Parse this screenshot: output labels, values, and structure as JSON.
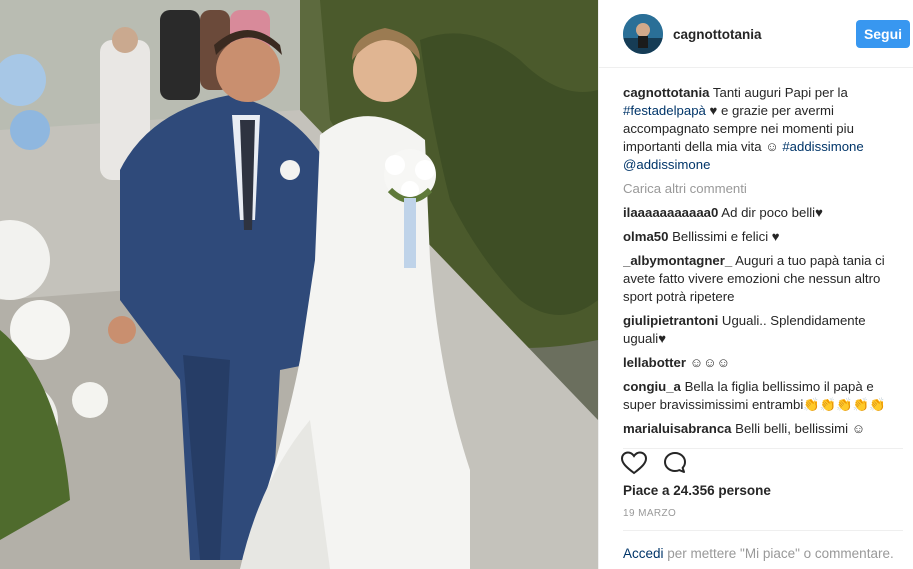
{
  "post": {
    "username": "cagnottotania",
    "follow_label": "Segui",
    "caption": {
      "username": "cagnottotania",
      "text_before": "Tanti auguri Papi per la ",
      "hashtag1": "#festadelpapà",
      "text_middle": " ♥ e grazie per avermi accompagnato sempre nei momenti piu importanti della mia vita ☺ ",
      "hashtag2": "#addissimone",
      "mention": "@addissimone"
    },
    "load_more": "Carica altri commenti",
    "comments": [
      {
        "user": "ilaaaaaaaaaaa0",
        "text": "Ad dir poco belli♥"
      },
      {
        "user": "olma50",
        "text": "Bellissimi e felici ♥"
      },
      {
        "user": "_albymontagner_",
        "text": "Auguri a tuo papà tania ci avete fatto vivere emozioni che nessun altro sport potrà ripetere"
      },
      {
        "user": "giulipietrantoni",
        "text": "Uguali.. Splendidamente uguali♥"
      },
      {
        "user": "lellabotter",
        "text": "☺☺☺"
      },
      {
        "user": "congiu_a",
        "text": "Bella la figlia bellissimo il papà e super bravissimissimi entrambi👏👏👏👏👏"
      },
      {
        "user": "marialuisabranca",
        "text": "Belli belli, bellissimi ☺"
      }
    ],
    "likes": "Piace a 24.356 persone",
    "date": "19 MARZO",
    "footer": {
      "login": "Accedi",
      "rest": " per mettere \"Mi piace\" o commentare."
    }
  },
  "icons": {
    "heart": "heart-icon",
    "comment": "comment-icon"
  }
}
